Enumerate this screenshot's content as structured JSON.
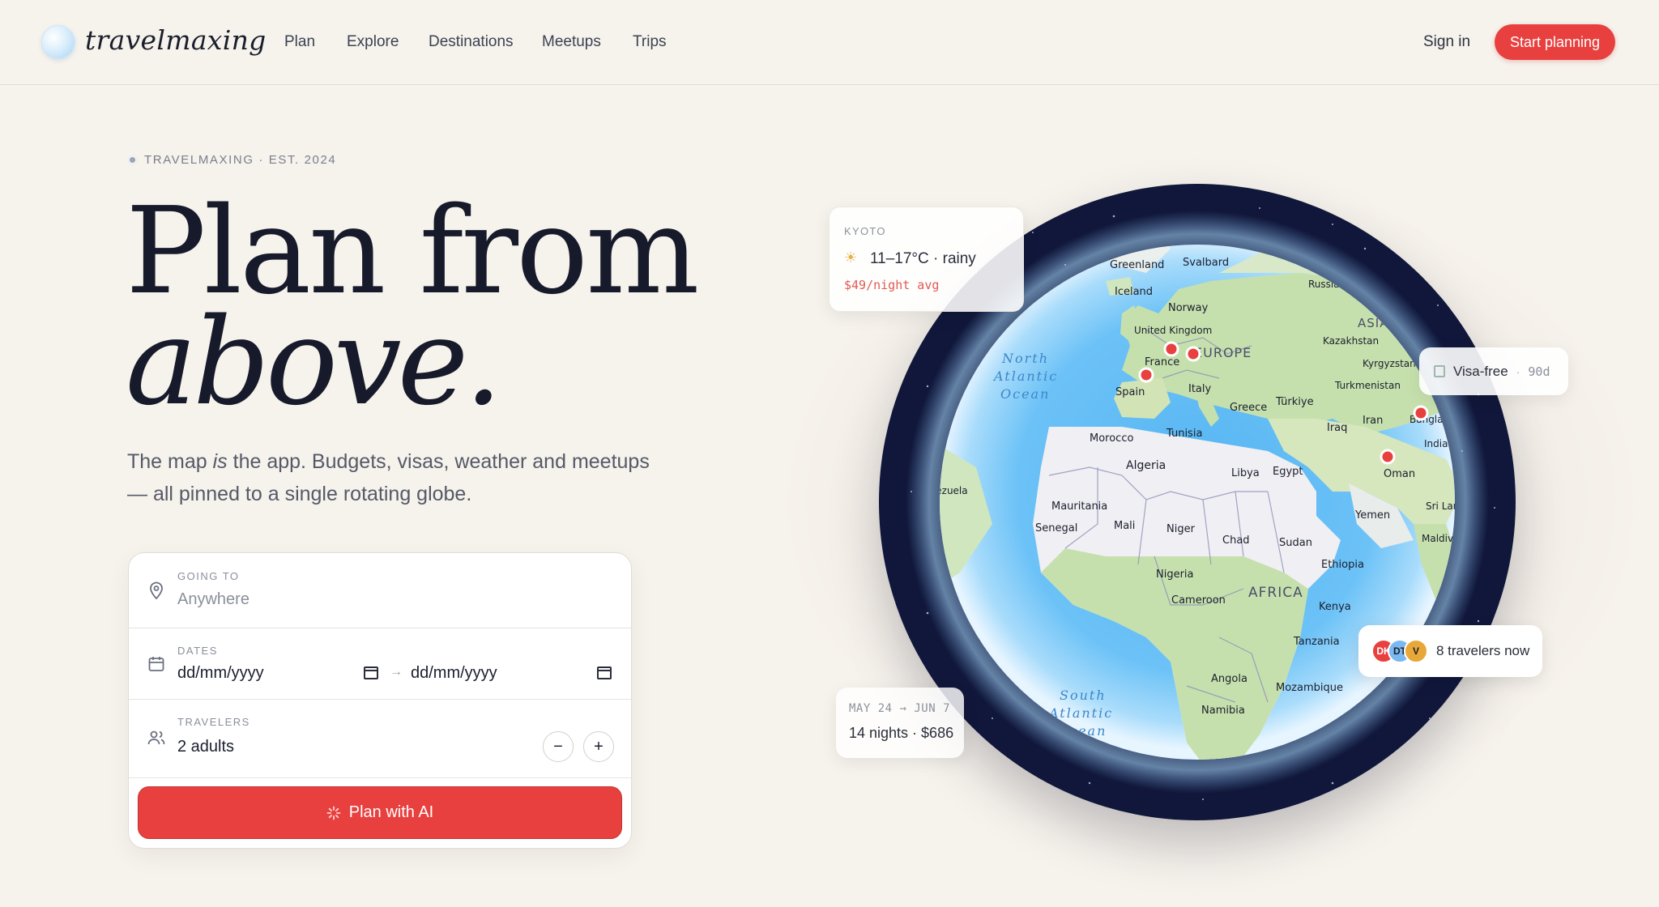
{
  "brand": {
    "name": "travelmaxing"
  },
  "nav": {
    "links": [
      "Plan",
      "Explore",
      "Destinations",
      "Meetups",
      "Trips"
    ],
    "signin": "Sign in",
    "cta": "Start planning"
  },
  "hero": {
    "eyebrow": "TRAVELMAXING · EST. 2024",
    "title_line1": "Plan from",
    "title_line2": "above.",
    "lede_pre": "The map ",
    "lede_em": "is",
    "lede_post": " the app. Budgets, visas, weather and meetups — all pinned to a single rotating globe."
  },
  "form": {
    "going_label": "GOING TO",
    "going_placeholder": "Anywhere",
    "dates_label": "DATES",
    "date_from": "dd/mm/yyyy",
    "date_to": "dd/mm/yyyy",
    "travelers_label": "TRAVELERS",
    "travelers_value": "2 adults",
    "minus": "−",
    "plus": "+",
    "submit": "Plan with AI"
  },
  "globe": {
    "labels": [
      "Greenland",
      "Svalbard",
      "Russia",
      "Iceland",
      "Norway",
      "United Kingdom",
      "EUROPE",
      "ASIA",
      "Kazakhstan",
      "Kyrgyzstan",
      "France",
      "Spain",
      "Italy",
      "Greece",
      "Türkiye",
      "Turkmenistan",
      "Iran",
      "Iraq",
      "Bangladesh",
      "India",
      "Morocco",
      "Tunisia",
      "Algeria",
      "Libya",
      "Egypt",
      "Oman",
      "Yemen",
      "Sri Lanka",
      "Maldives",
      "Venezuela",
      "Mauritania",
      "Senegal",
      "Mali",
      "Niger",
      "Chad",
      "Sudan",
      "Ethiopia",
      "Nigeria",
      "Cameroon",
      "AFRICA",
      "Kenya",
      "Tanzania",
      "Angola",
      "Mozambique",
      "Namibia",
      "North Atlantic Ocean",
      "South Atlantic Ocean"
    ]
  },
  "weather_card": {
    "city": "KYOTO",
    "temp": "11–17°C · rainy",
    "price": "$49/night avg",
    "icon": "sun-icon"
  },
  "visa_card": {
    "label": "Visa-free",
    "sep": "·",
    "days": "90d"
  },
  "travelers_card": {
    "avatars": [
      "DK",
      "DT",
      "V"
    ],
    "colors": [
      "#e8403e",
      "#7ab8f0",
      "#e8a838"
    ],
    "label": "8 travelers now"
  },
  "trip_card": {
    "dates": "MAY 24 → JUN 7",
    "info": "14 nights · $686"
  }
}
